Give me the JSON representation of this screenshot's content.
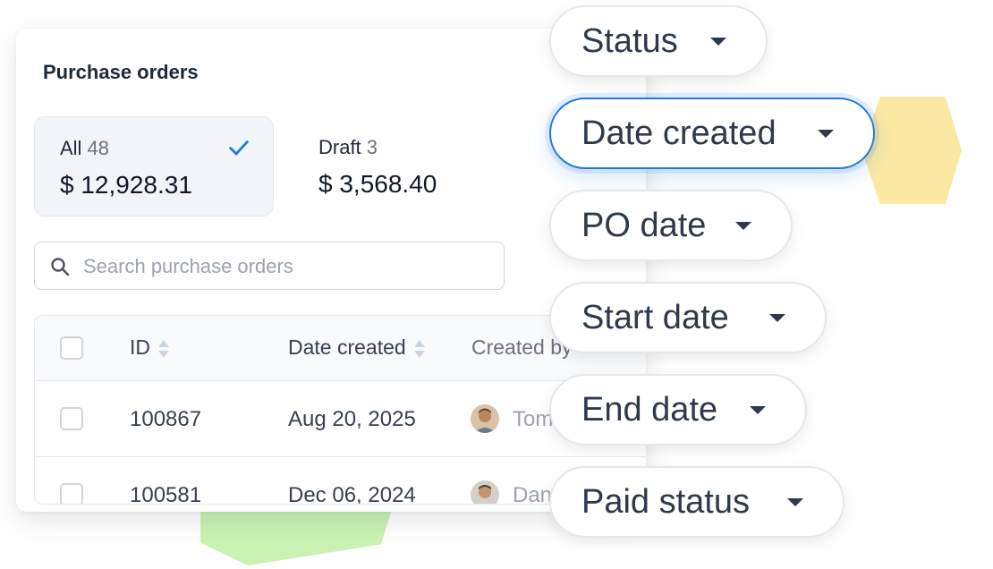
{
  "card": {
    "title": "Purchase orders",
    "tabs": [
      {
        "name": "All",
        "count": "48",
        "amount": "$ 12,928.31",
        "active": true
      },
      {
        "name": "Draft",
        "count": "3",
        "amount": "$ 3,568.40",
        "active": false
      }
    ],
    "search": {
      "placeholder": "Search purchase orders",
      "value": ""
    },
    "table": {
      "columns": [
        "ID",
        "Date created",
        "Created by"
      ],
      "rows": [
        {
          "id": "100867",
          "date": "Aug 20, 2025",
          "created_by": "Tom"
        },
        {
          "id": "100581",
          "date": "Dec 06, 2024",
          "created_by": "Dan"
        }
      ]
    }
  },
  "filters": [
    {
      "label": "Status",
      "focused": false
    },
    {
      "label": "Date created",
      "focused": true
    },
    {
      "label": "PO date",
      "focused": false
    },
    {
      "label": "Start date",
      "focused": false
    },
    {
      "label": "End date",
      "focused": false
    },
    {
      "label": "Paid status",
      "focused": false
    }
  ],
  "colors": {
    "accent": "#1f7ae0",
    "deco_green": "#c9f2b3",
    "deco_yellow": "#fbe9a3"
  }
}
